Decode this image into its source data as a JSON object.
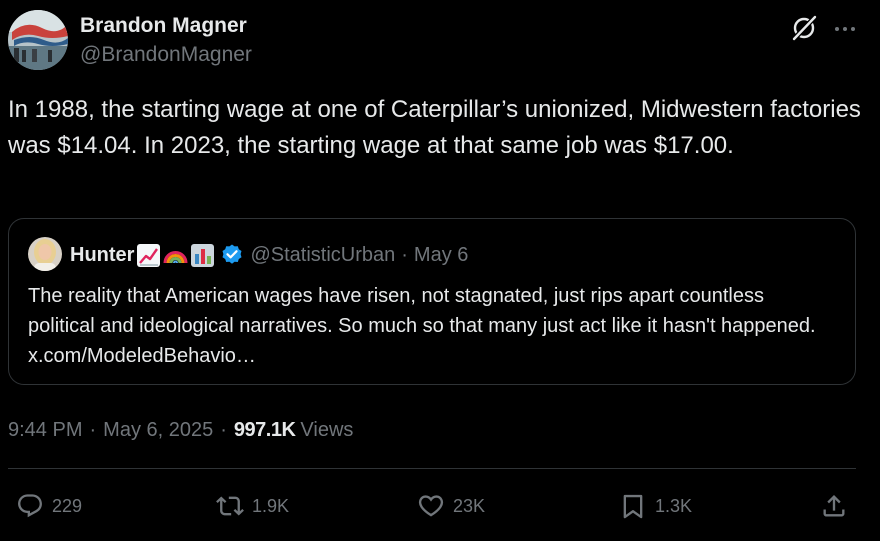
{
  "author": {
    "display_name": "Brandon Magner",
    "handle": "@BrandonMagner"
  },
  "header_icons": {
    "grok": "grok-icon",
    "more": "more-icon"
  },
  "tweet": {
    "text": "In 1988, the starting wage at one of Caterpillar’s unionized, Midwestern factories was $14.04. In 2023, the starting wage at that same job was $17.00."
  },
  "quote": {
    "display_name": "Hunter",
    "name_emojis": [
      "chart-increasing-emoji",
      "rainbow-emoji",
      "bar-chart-emoji"
    ],
    "verified_icon": "verified-badge-icon",
    "handle": "@StatisticUrban",
    "separator": "·",
    "date": "May 6",
    "text": "The reality that American wages have risen, not stagnated, just rips apart countless political and ideological narratives. So much so that many just act like it hasn't happened. x.com/ModeledBehavio…"
  },
  "meta": {
    "time": "9:44 PM",
    "sep1": "·",
    "date": "May 6, 2025",
    "sep2": "·",
    "views_count": "997.1K",
    "views_label": "Views"
  },
  "actions": {
    "reply": {
      "icon": "reply-icon",
      "count": "229"
    },
    "repost": {
      "icon": "repost-icon",
      "count": "1.9K"
    },
    "like": {
      "icon": "heart-icon",
      "count": "23K"
    },
    "bookmark": {
      "icon": "bookmark-icon",
      "count": "1.3K"
    },
    "share": {
      "icon": "share-icon"
    }
  },
  "colors": {
    "background": "#000000",
    "text_primary": "#e7e9ea",
    "text_secondary": "#71767b",
    "border": "#2f3336",
    "verified": "#1d9bf0"
  }
}
